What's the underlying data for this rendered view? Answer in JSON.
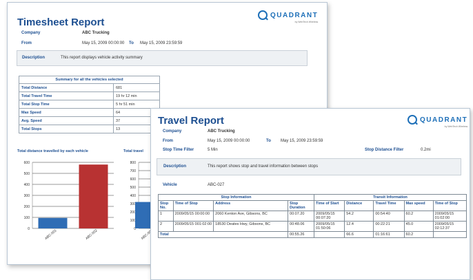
{
  "timesheet": {
    "title": "Timesheet Report",
    "company_label": "Company",
    "company": "ABC Trucking",
    "from_label": "From",
    "from": "May 15, 2009 00:00:00",
    "to_label": "To",
    "to": "May 15, 2009 23:59:59",
    "description_label": "Description",
    "description": "This report displays vehicle activity summary",
    "summary_title": "Summary for all the vehicles selected",
    "summary": [
      {
        "k": "Total Distance",
        "v": "681"
      },
      {
        "k": "Total Travel Time",
        "v": "19 hr 12 min"
      },
      {
        "k": "Total Stop Time",
        "v": "5 hr 51 min"
      },
      {
        "k": "Max Speed",
        "v": "64"
      },
      {
        "k": "Avg. Speed",
        "v": "37"
      },
      {
        "k": "Total Stops",
        "v": "13"
      }
    ],
    "chart1_title": "Total distance travelled by each vehicle",
    "chart2_title": "Total travel"
  },
  "logo": {
    "brand": "QUADRANT",
    "sub": "by WebTech Wireless"
  },
  "chart_data": [
    {
      "type": "bar",
      "title": "Total distance travelled by each vehicle",
      "categories": [
        "ABC-001",
        "ABC-002"
      ],
      "values": [
        95,
        580
      ],
      "colors": [
        "#2f6db5",
        "#b83232"
      ],
      "ylim": [
        0,
        600
      ],
      "yticks": [
        0,
        100,
        200,
        300,
        400,
        500,
        600
      ]
    },
    {
      "type": "bar",
      "title": "Total travel",
      "categories": [
        "ABC-001"
      ],
      "values": [
        320
      ],
      "colors": [
        "#2f6db5"
      ],
      "ylim": [
        0,
        800
      ],
      "yticks": [
        0,
        100,
        200,
        300,
        400,
        500,
        600,
        700,
        800
      ]
    }
  ],
  "travel": {
    "title": "Travel Report",
    "company_label": "Company",
    "company": "ABC Trucking",
    "from_label": "From",
    "from": "May 15, 2009 00:00:00",
    "to_label": "To",
    "to": "May 15, 2009 23:59:59",
    "stop_filter_label": "Stop Time Filter",
    "stop_filter": "5 Min",
    "distance_filter_label": "Stop Distance Filter",
    "distance_filter": "0.2mi",
    "description_label": "Description",
    "description": "This report shows stop and travel information between stops",
    "vehicle_label": "Vehicle",
    "vehicle": "ABC-027",
    "group_stop": "Stop Information",
    "group_transit": "Transit Information",
    "headers": [
      "Stop No.",
      "Time of Stop",
      "Address",
      "Stop Duration",
      "Time of Start",
      "Distance",
      "Travel Time",
      "Max speed",
      "Time of Stop"
    ],
    "rows": [
      [
        "1",
        "2009/05/15 00:00:00",
        "2060 Kenton Ave, Gibsons, BC",
        "00:07.20",
        "2009/05/15 00:07:20",
        "54.2",
        "00:54:40",
        "60.2",
        "2009/05/15 01:02:00"
      ],
      [
        "2",
        "2009/05/15 001:02:00",
        "18530 Deates Hwy, Gibsons, BC",
        "00:48.06",
        "2009/05/15 01:50:06",
        "12.4",
        "00:22:21",
        "45.0",
        "2009/05/15 02:12:37"
      ]
    ],
    "total": {
      "label": "Total",
      "duration": "00:55.26",
      "distance": "66.6",
      "travel_time": "01:16:61",
      "max_speed": "60.2"
    }
  }
}
